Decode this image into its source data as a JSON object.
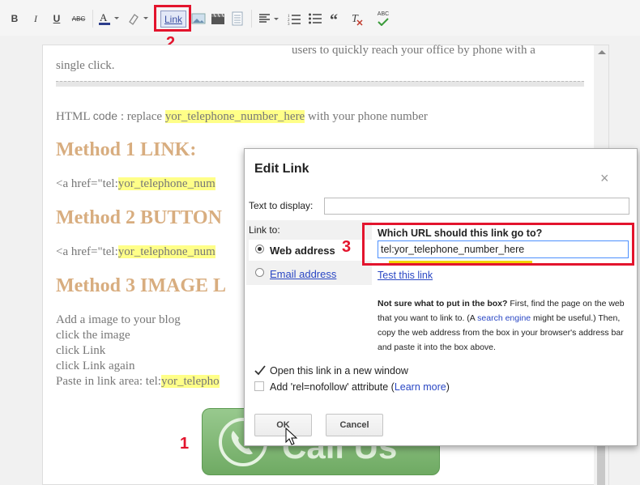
{
  "toolbar": {
    "bold": "B",
    "italic": "I",
    "underline": "U",
    "strike": "ABC",
    "link_label": "Link",
    "spell": "ABC"
  },
  "annotations": {
    "n1": "1",
    "n2": "2",
    "n3": "3"
  },
  "editor": {
    "line1": "users to quickly reach your office by phone with a",
    "line2": "single click.",
    "html_prefix": "HTML",
    "html_code_word": "code",
    "html_replace": ": replace",
    "html_placeholder": "yor_telephone_number_here",
    "html_suffix": "with your phone number",
    "method1": "Method 1 LINK:",
    "method2": "Method 2 BUTTON",
    "method3": "Method 3 IMAGE L",
    "code_prefix": "<a href=\"tel:",
    "code_hl": "yor_telephone_num",
    "steps": [
      "Add a image to your blog",
      "click the image",
      "click Link",
      "click Link again"
    ],
    "paste_prefix": "Paste in link area: tel:",
    "paste_hl": "yor_telepho",
    "call_text": "Call Us"
  },
  "dialog": {
    "title": "Edit Link",
    "close": "×",
    "text_to_display_label": "Text to display:",
    "text_to_display_value": "",
    "link_to_label": "Link to:",
    "options": [
      "Web address",
      "Email address"
    ],
    "question": "Which URL should this link go to?",
    "url_value": "tel:yor_telephone_number_here",
    "test_link": "Test this link",
    "help_bold": "Not sure what to put in the box?",
    "help_1": " First, find the page on the web that you want to link to. (A ",
    "help_link": "search engine",
    "help_2": " might be useful.) Then, copy the web address from the box in your browser's address bar and paste it into the box above.",
    "open_new_window": "Open this link in a new window",
    "nofollow_prefix": "Add 'rel=nofollow' attribute (",
    "learn_more": "Learn more",
    "nofollow_suffix": ")",
    "ok": "OK",
    "cancel": "Cancel"
  },
  "colors": {
    "accent_red": "#e3142d",
    "highlight": "#ffff88",
    "method_heading": "#d8ad7f",
    "link_blue": "#2a47c4"
  }
}
